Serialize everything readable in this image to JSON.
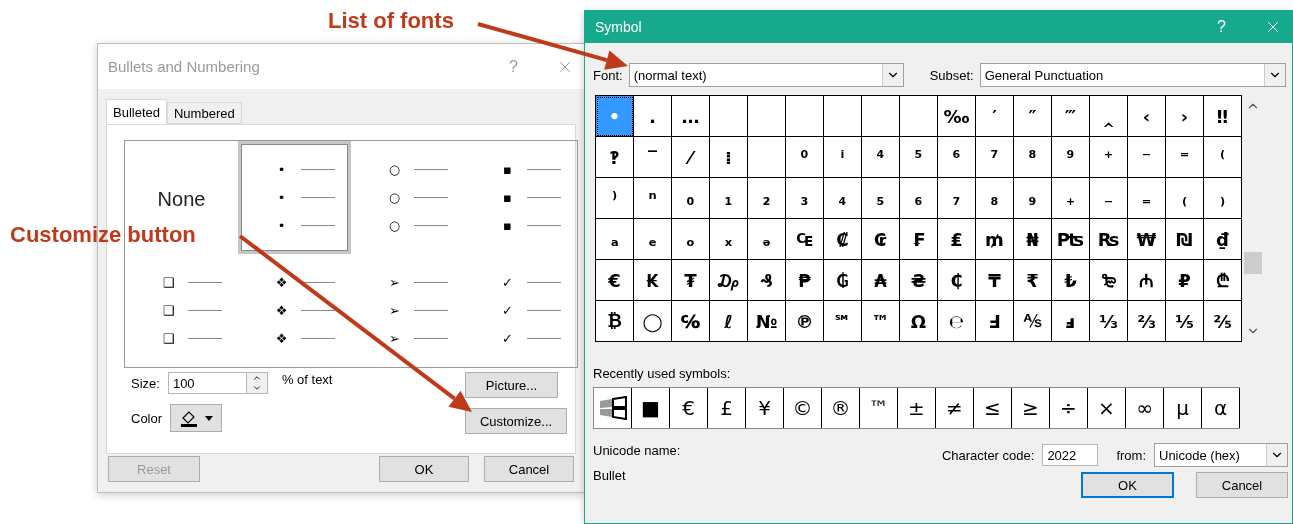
{
  "annotations": [
    {
      "text": "List of fonts"
    },
    {
      "text": "Customize button"
    }
  ],
  "bullets_dialog": {
    "title": "Bullets and Numbering",
    "help": "?",
    "tabs": [
      {
        "label": "Bulleted",
        "selected": true
      },
      {
        "label": "Numbered",
        "selected": false
      }
    ],
    "gallery": [
      {
        "kind": "none",
        "label": "None",
        "selected": false
      },
      {
        "kind": "bullet",
        "symbols": [
          "•",
          "•",
          "•"
        ],
        "selected": true
      },
      {
        "kind": "bullet",
        "symbols": [
          "○",
          "○",
          "○"
        ],
        "selected": false
      },
      {
        "kind": "bullet",
        "symbols": [
          "▪",
          "▪",
          "▪"
        ],
        "selected": false
      },
      {
        "kind": "bullet",
        "symbols": [
          "❑",
          "❑",
          "❑"
        ],
        "selected": false
      },
      {
        "kind": "bullet",
        "symbols": [
          "❖",
          "❖",
          "❖"
        ],
        "selected": false
      },
      {
        "kind": "bullet",
        "symbols": [
          "➢",
          "➢",
          "➢"
        ],
        "selected": false
      },
      {
        "kind": "bullet",
        "symbols": [
          "✓",
          "✓",
          "✓"
        ],
        "selected": false
      }
    ],
    "size": {
      "label": "Size:",
      "value": "100",
      "unit": "% of text"
    },
    "color": {
      "label": "Color"
    },
    "buttons": {
      "picture": "Picture...",
      "customize": "Customize...",
      "reset": "Reset",
      "ok": "OK",
      "cancel": "Cancel"
    },
    "reset_disabled": true
  },
  "symbol_dialog": {
    "title": "Symbol",
    "help": "?",
    "font": {
      "label": "Font:",
      "value": "(normal text)"
    },
    "subset": {
      "label": "Subset:",
      "value": "General Punctuation"
    },
    "grid": [
      {
        "cells": [
          {
            "symbol": "•",
            "selected": true
          },
          {
            "symbol": "․",
            "selected": false
          },
          {
            "symbol": "…",
            "selected": false
          },
          {
            "selected": false
          },
          {
            "selected": false
          },
          {
            "selected": false
          },
          {
            "selected": false
          },
          {
            "selected": false
          },
          {
            "selected": false
          },
          {
            "symbol": "‰",
            "selected": false
          },
          {
            "symbol": "′",
            "selected": false
          },
          {
            "symbol": "″",
            "selected": false
          },
          {
            "symbol": "‴",
            "selected": false
          },
          {
            "symbol": "‸",
            "selected": false
          },
          {
            "symbol": "‹",
            "selected": false
          },
          {
            "symbol": "›",
            "selected": false
          },
          {
            "symbol": "‼",
            "selected": false
          }
        ]
      },
      {
        "cells": [
          {
            "symbol": "‽",
            "selected": false
          },
          {
            "symbol": "‾",
            "selected": false
          },
          {
            "symbol": "⁄",
            "selected": false
          },
          {
            "symbol": "⁞",
            "selected": false
          },
          {
            "selected": false
          },
          {
            "symbol": "⁰",
            "selected": false
          },
          {
            "symbol": "ⁱ",
            "selected": false
          },
          {
            "symbol": "⁴",
            "selected": false
          },
          {
            "symbol": "⁵",
            "selected": false
          },
          {
            "symbol": "⁶",
            "selected": false
          },
          {
            "symbol": "⁷",
            "selected": false
          },
          {
            "symbol": "⁸",
            "selected": false
          },
          {
            "symbol": "⁹",
            "selected": false
          },
          {
            "symbol": "⁺",
            "selected": false
          },
          {
            "symbol": "⁻",
            "selected": false
          },
          {
            "symbol": "⁼",
            "selected": false
          },
          {
            "symbol": "⁽",
            "selected": false
          }
        ]
      },
      {
        "cells": [
          {
            "symbol": "⁾",
            "selected": false
          },
          {
            "symbol": "ⁿ",
            "selected": false
          },
          {
            "symbol": "₀",
            "selected": false
          },
          {
            "symbol": "₁",
            "selected": false
          },
          {
            "symbol": "₂",
            "selected": false
          },
          {
            "symbol": "₃",
            "selected": false
          },
          {
            "symbol": "₄",
            "selected": false
          },
          {
            "symbol": "₅",
            "selected": false
          },
          {
            "symbol": "₆",
            "selected": false
          },
          {
            "symbol": "₇",
            "selected": false
          },
          {
            "symbol": "₈",
            "selected": false
          },
          {
            "symbol": "₉",
            "selected": false
          },
          {
            "symbol": "₊",
            "selected": false
          },
          {
            "symbol": "₋",
            "selected": false
          },
          {
            "symbol": "₌",
            "selected": false
          },
          {
            "symbol": "₍",
            "selected": false
          },
          {
            "symbol": "₎",
            "selected": false
          }
        ]
      },
      {
        "cells": [
          {
            "symbol": "ₐ",
            "selected": false
          },
          {
            "symbol": "ₑ",
            "selected": false
          },
          {
            "symbol": "ₒ",
            "selected": false
          },
          {
            "symbol": "ₓ",
            "selected": false
          },
          {
            "symbol": "ₔ",
            "selected": false
          },
          {
            "symbol": "₠",
            "selected": false
          },
          {
            "symbol": "₡",
            "selected": false
          },
          {
            "symbol": "₢",
            "selected": false
          },
          {
            "symbol": "₣",
            "selected": false
          },
          {
            "symbol": "₤",
            "selected": false
          },
          {
            "symbol": "₥",
            "selected": false
          },
          {
            "symbol": "₦",
            "selected": false
          },
          {
            "symbol": "₧",
            "selected": false
          },
          {
            "symbol": "₨",
            "selected": false
          },
          {
            "symbol": "₩",
            "selected": false
          },
          {
            "symbol": "₪",
            "selected": false
          },
          {
            "symbol": "₫",
            "selected": false
          }
        ]
      },
      {
        "cells": [
          {
            "symbol": "€",
            "selected": false
          },
          {
            "symbol": "₭",
            "selected": false
          },
          {
            "symbol": "₮",
            "selected": false
          },
          {
            "symbol": "₯",
            "selected": false
          },
          {
            "symbol": "₰",
            "selected": false
          },
          {
            "symbol": "₱",
            "selected": false
          },
          {
            "symbol": "₲",
            "selected": false
          },
          {
            "symbol": "₳",
            "selected": false
          },
          {
            "symbol": "₴",
            "selected": false
          },
          {
            "symbol": "₵",
            "selected": false
          },
          {
            "symbol": "₸",
            "selected": false
          },
          {
            "symbol": "₹",
            "selected": false
          },
          {
            "symbol": "₺",
            "selected": false
          },
          {
            "symbol": "₻",
            "selected": false
          },
          {
            "symbol": "₼",
            "selected": false
          },
          {
            "symbol": "₽",
            "selected": false
          },
          {
            "symbol": "₾",
            "selected": false
          }
        ]
      },
      {
        "cells": [
          {
            "symbol": "₿",
            "selected": false
          },
          {
            "symbol": "◯",
            "selected": false
          },
          {
            "symbol": "℅",
            "selected": false
          },
          {
            "symbol": "ℓ",
            "selected": false
          },
          {
            "symbol": "№",
            "selected": false
          },
          {
            "symbol": "℗",
            "selected": false
          },
          {
            "symbol": "℠",
            "selected": false
          },
          {
            "symbol": "™",
            "selected": false
          },
          {
            "symbol": "Ω",
            "selected": false
          },
          {
            "symbol": "℮",
            "selected": false
          },
          {
            "symbol": "Ⅎ",
            "selected": false
          },
          {
            "symbol": "⅍",
            "selected": false
          },
          {
            "symbol": "ⅎ",
            "selected": false
          },
          {
            "symbol": "⅓",
            "selected": false
          },
          {
            "symbol": "⅔",
            "selected": false
          },
          {
            "symbol": "⅕",
            "selected": false
          },
          {
            "symbol": "⅖",
            "selected": false
          }
        ]
      }
    ],
    "recent_label": "Recently used symbols:",
    "recent": [
      {
        "kind": "logo"
      },
      {
        "kind": "char",
        "symbol": "■"
      },
      {
        "kind": "char",
        "symbol": "€"
      },
      {
        "kind": "char",
        "symbol": "£"
      },
      {
        "kind": "char",
        "symbol": "¥"
      },
      {
        "kind": "char",
        "symbol": "©"
      },
      {
        "kind": "char",
        "symbol": "®"
      },
      {
        "kind": "char",
        "symbol": "™"
      },
      {
        "kind": "char",
        "symbol": "±"
      },
      {
        "kind": "char",
        "symbol": "≠"
      },
      {
        "kind": "char",
        "symbol": "≤"
      },
      {
        "kind": "char",
        "symbol": "≥"
      },
      {
        "kind": "char",
        "symbol": "÷"
      },
      {
        "kind": "char",
        "symbol": "×"
      },
      {
        "kind": "char",
        "symbol": "∞"
      },
      {
        "kind": "char",
        "symbol": "µ"
      },
      {
        "kind": "char",
        "symbol": "α"
      }
    ],
    "unicode_name_label": "Unicode name:",
    "unicode_name": "Bullet",
    "char_code": {
      "label": "Character code:",
      "value": "2022"
    },
    "from": {
      "label": "from:",
      "value": "Unicode (hex)"
    },
    "buttons": {
      "ok": "OK",
      "cancel": "Cancel"
    }
  }
}
